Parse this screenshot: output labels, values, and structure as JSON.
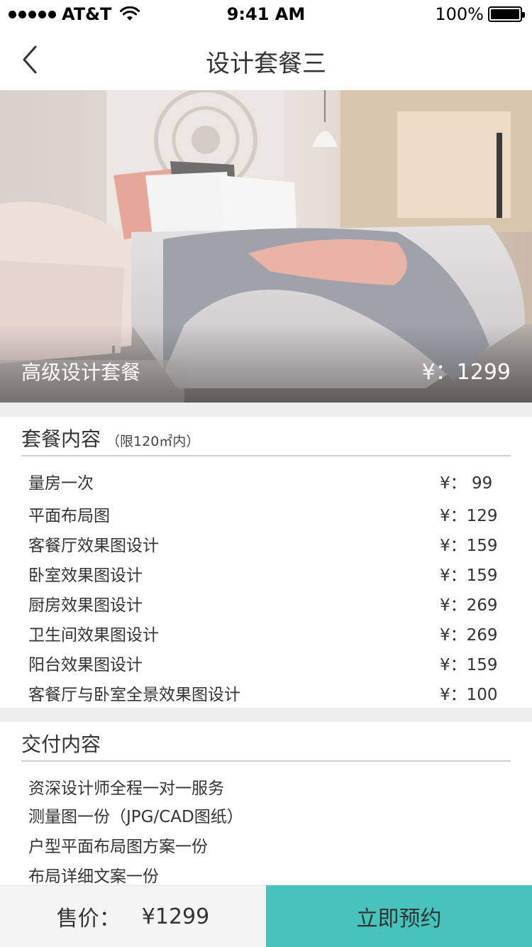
{
  "status_bar": {
    "carrier": "AT&T",
    "time": "9:41 AM",
    "battery": "100%"
  },
  "nav": {
    "title": "设计套餐三",
    "back_icon": "chevron-left-icon"
  },
  "hero": {
    "package_name": "高级设计套餐",
    "price": "¥：1299"
  },
  "package_section": {
    "title": "套餐内容",
    "note": "（限120㎡内）",
    "items": [
      {
        "label": "量房一次",
        "price": "¥：  99"
      },
      {
        "label": "平面布局图",
        "price": "¥：129"
      },
      {
        "label": "客餐厅效果图设计",
        "price": "¥：159"
      },
      {
        "label": "卧室效果图设计",
        "price": "¥：159"
      },
      {
        "label": "厨房效果图设计",
        "price": "¥：269"
      },
      {
        "label": "卫生间效果图设计",
        "price": "¥：269"
      },
      {
        "label": "阳台效果图设计",
        "price": "¥：159"
      },
      {
        "label": "客餐厅与卧室全景效果图设计",
        "price": "¥：100"
      }
    ]
  },
  "delivery_section": {
    "title": "交付内容",
    "items": [
      "资深设计师全程一对一服务",
      "测量图一份（JPG/CAD图纸）",
      "户型平面布局图方案一份",
      "布局详细文案一份"
    ]
  },
  "bottom_bar": {
    "price_label": "售价：",
    "price_value": "¥1299",
    "book_label": "立即预约"
  },
  "colors": {
    "accent": "#46c3bd",
    "divider": "#eeeeee"
  }
}
